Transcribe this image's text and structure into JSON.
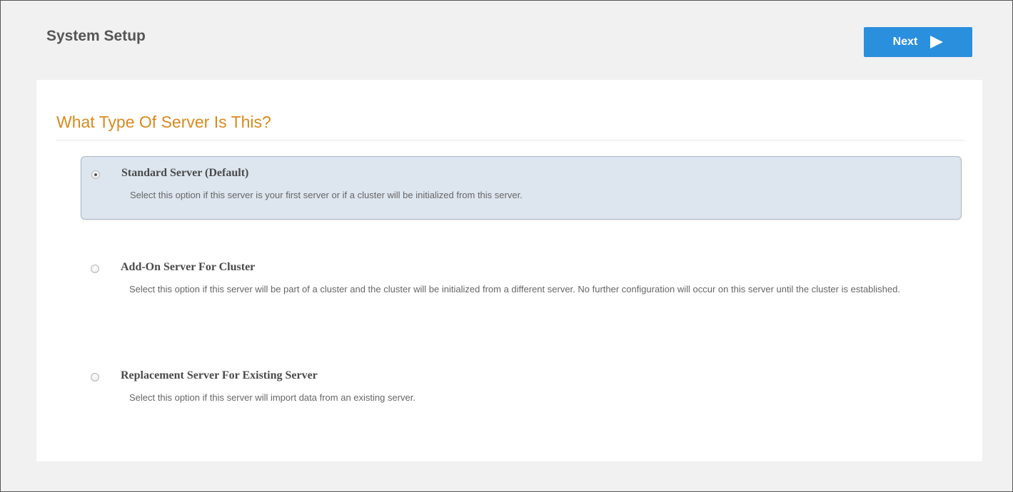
{
  "header": {
    "title": "System Setup",
    "next_label": "Next"
  },
  "section": {
    "title": "What Type Of Server Is This?"
  },
  "options": [
    {
      "label": "Standard Server (Default)",
      "description": "Select this option if this server is your first server or if a cluster will be initialized from this server.",
      "selected": true
    },
    {
      "label": "Add-On Server For Cluster",
      "description": "Select this option if this server will be part of a cluster and the cluster will be initialized from a different server. No further configuration will occur on this server until the cluster is established.",
      "selected": false
    },
    {
      "label": "Replacement Server For Existing Server",
      "description": "Select this option if this server will import data from an existing server.",
      "selected": false
    }
  ],
  "colors": {
    "accent_button": "#2a8fdc",
    "section_title": "#d98a1e",
    "selected_option_bg": "#dde6ef"
  },
  "icons": {
    "next": "play-arrow-icon",
    "option": "radio-icon"
  }
}
